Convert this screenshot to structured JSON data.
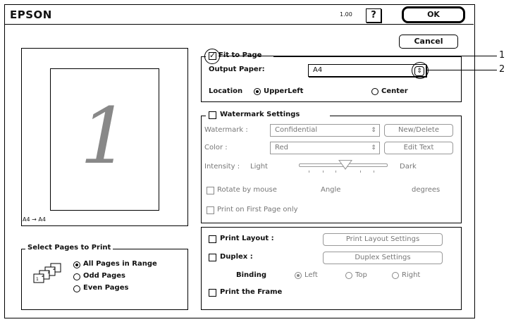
{
  "header": {
    "brand": "EPSON",
    "version": "1.00",
    "help_label": "?",
    "ok_label": "OK",
    "cancel_label": "Cancel"
  },
  "preview": {
    "page_number": "1",
    "paper_label": "A4 → A4"
  },
  "select_pages": {
    "title": "Select Pages to Print",
    "options": [
      {
        "label": "All Pages in Range",
        "selected": true
      },
      {
        "label": "Odd Pages",
        "selected": false
      },
      {
        "label": "Even Pages",
        "selected": false
      }
    ]
  },
  "fit_to_page": {
    "checkbox_label": "Fit to Page",
    "checked": true,
    "output_paper_label": "Output Paper:",
    "output_paper_value": "A4",
    "location_label": "Location",
    "location_options": [
      {
        "label": "UpperLeft",
        "selected": true
      },
      {
        "label": "Center",
        "selected": false
      }
    ]
  },
  "watermark": {
    "checkbox_label": "Watermark Settings",
    "checked": false,
    "watermark_label": "Watermark :",
    "watermark_value": "Confidential",
    "new_delete_label": "New/Delete",
    "color_label": "Color :",
    "color_value": "Red",
    "edit_text_label": "Edit Text",
    "intensity_label": "Intensity :",
    "intensity_light": "Light",
    "intensity_dark": "Dark",
    "intensity_level": 0.5,
    "rotate_label": "Rotate by mouse",
    "angle_label": "Angle",
    "degrees_label": "degrees",
    "first_page_label": "Print on First Page only"
  },
  "layout": {
    "print_layout_label": "Print Layout :",
    "print_layout_settings_label": "Print Layout Settings",
    "duplex_label": "Duplex :",
    "duplex_settings_label": "Duplex Settings",
    "binding_label": "Binding",
    "binding_options": [
      {
        "label": "Left",
        "selected": true
      },
      {
        "label": "Top",
        "selected": false
      },
      {
        "label": "Right",
        "selected": false
      }
    ],
    "print_frame_label": "Print the Frame"
  },
  "callouts": [
    "1",
    "2"
  ]
}
